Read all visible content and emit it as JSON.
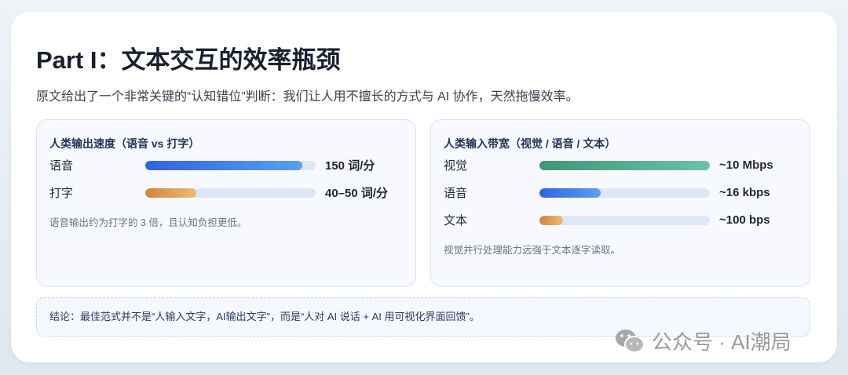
{
  "title": "Part I：文本交互的效率瓶颈",
  "subtitle": "原文给出了一个非常关键的“认知错位”判断：我们让人用不擅长的方式与 AI 协作，天然拖慢效率。",
  "left_panel": {
    "title": "人类输出速度（语音 vs 打字）",
    "rows": [
      {
        "label": "语音",
        "value": "150 词/分",
        "fill_percent": 92,
        "color": "blue"
      },
      {
        "label": "打字",
        "value": "40–50 词/分",
        "fill_percent": 30,
        "color": "orange"
      }
    ],
    "note": "语音输出约为打字的 3 倍，且认知负担更低。"
  },
  "right_panel": {
    "title": "人类输入带宽（视觉 / 语音 / 文本）",
    "rows": [
      {
        "label": "视觉",
        "value": "~10 Mbps",
        "fill_percent": 100,
        "color": "green"
      },
      {
        "label": "语音",
        "value": "~16 kbps",
        "fill_percent": 36,
        "color": "blue"
      },
      {
        "label": "文本",
        "value": "~100 bps",
        "fill_percent": 14,
        "color": "orange"
      }
    ],
    "note": "视觉并行处理能力远强于文本逐字读取。"
  },
  "conclusion": "结论：最佳范式并不是“人输入文字，AI输出文字”，而是“人对 AI 说话 + AI 用可视化界面回馈”。",
  "watermark": "公众号 · AI潮局",
  "colors": {
    "blue": "linear-gradient(90deg,#2f63e0,#5aa0f0)",
    "orange": "linear-gradient(90deg,#d4843a,#ecbb78)",
    "green": "linear-gradient(90deg,#3f9678,#6cc2a6)"
  }
}
